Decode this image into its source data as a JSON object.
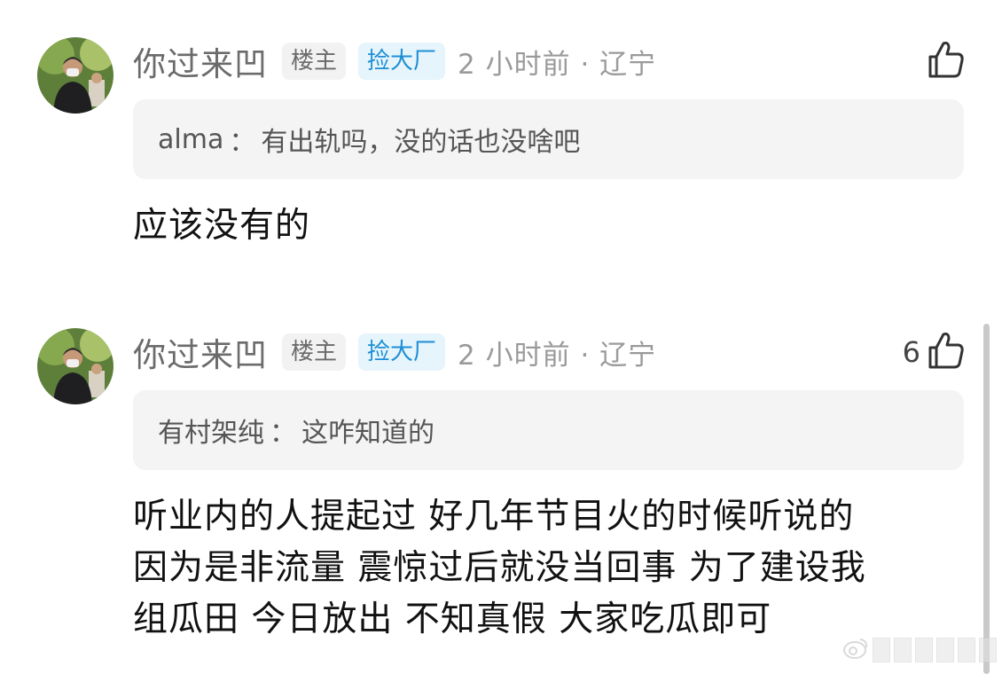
{
  "comments": [
    {
      "username": "你过来凹",
      "op_badge": "楼主",
      "tag_badge": "捡大厂",
      "meta": "2 小时前 · 辽宁",
      "like_count": "",
      "quote_name": "alma",
      "quote_sep": "：",
      "quote_text": "有出轨吗，没的话也没啥吧",
      "body": "应该没有的"
    },
    {
      "username": "你过来凹",
      "op_badge": "楼主",
      "tag_badge": "捡大厂",
      "meta": "2 小时前 · 辽宁",
      "like_count": "6",
      "quote_name": "有村架纯",
      "quote_sep": "：",
      "quote_text": "这咋知道的",
      "body_lines": [
        "听业内的人提起过 好几年节目火的时候听说的",
        "因为是非流量 震惊过后就没当回事 为了建设我",
        "组瓜田 今日放出 不知真假 大家吃瓜即可"
      ]
    }
  ],
  "icons": {
    "like": "thumbs-up-icon",
    "avatar": "user-avatar-photo"
  },
  "colors": {
    "tag_blue": "#1d8fd6",
    "tag_bg": "#e6f4fb",
    "quote_bg": "#f4f4f4",
    "meta_gray": "#9a9a9a"
  }
}
